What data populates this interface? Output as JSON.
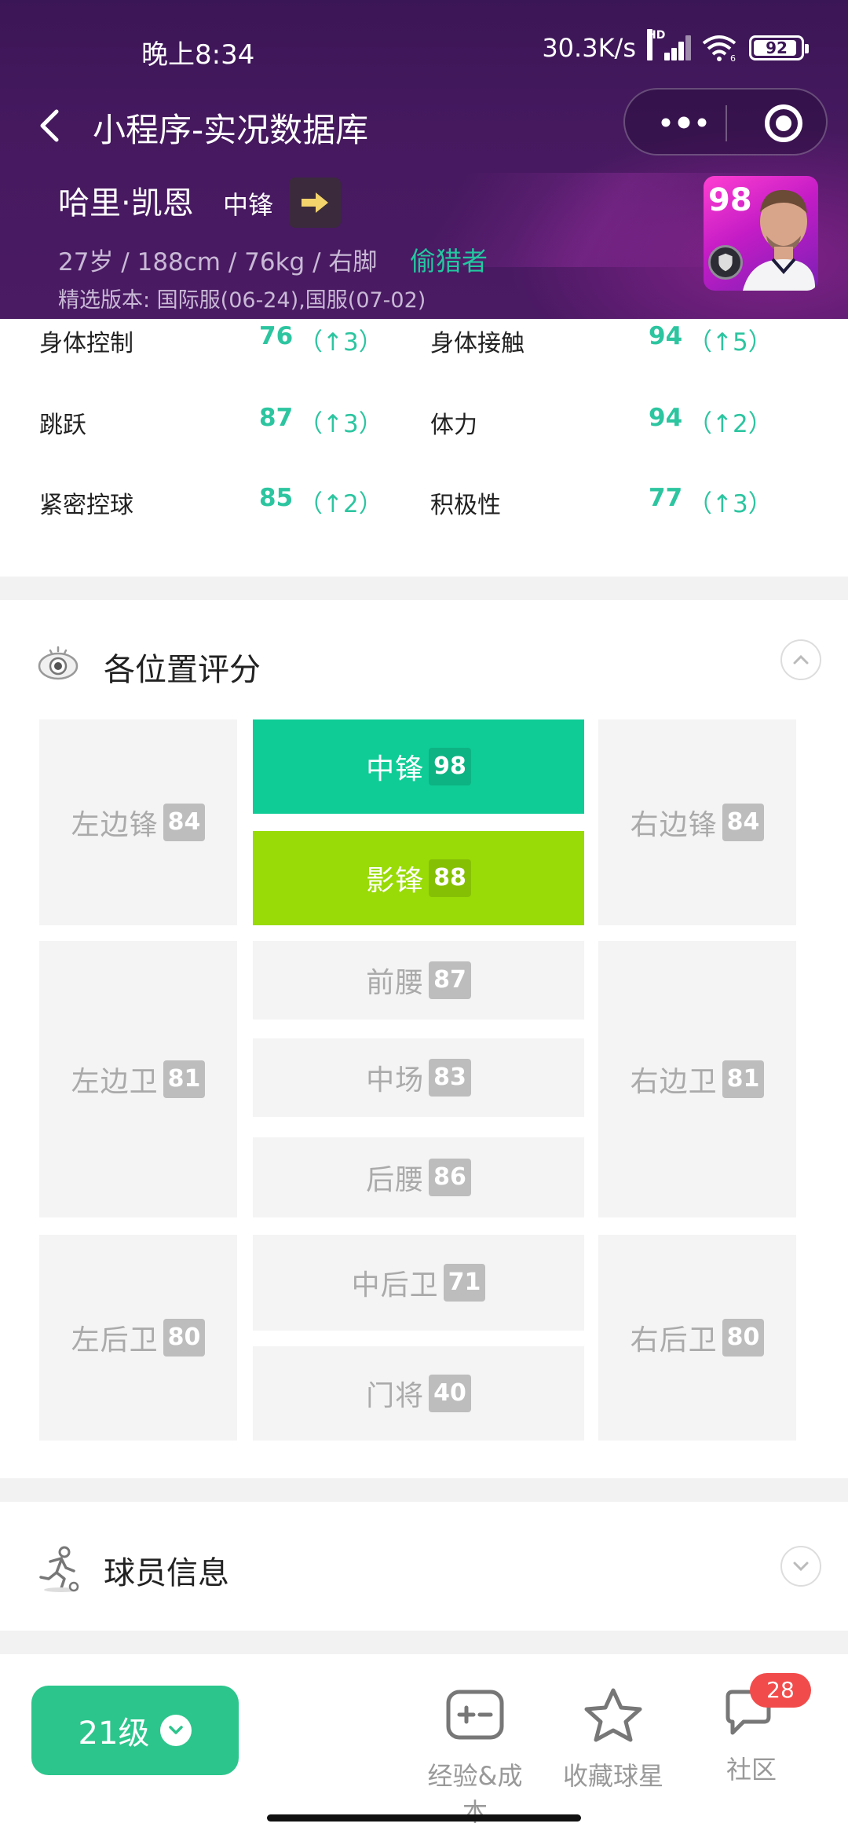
{
  "status": {
    "time": "晚上8:34",
    "net_speed": "30.3K/s",
    "signal_tag": "HD",
    "wifi_tag": "6",
    "battery": "92"
  },
  "nav": {
    "title": "小程序-实况数据库"
  },
  "player": {
    "name": "哈里·凯恩",
    "position": "中锋",
    "meta": "27岁 / 188cm / 76kg / 右脚",
    "style": "偷猎者",
    "version": "精选版本: 国际服(06-24),国服(07-02)",
    "card_rating": "98"
  },
  "attributes": [
    {
      "name": "身体控制",
      "value": "76",
      "delta": "（↑3）"
    },
    {
      "name": "身体接触",
      "value": "94",
      "delta": "（↑5）"
    },
    {
      "name": "跳跃",
      "value": "87",
      "delta": "（↑3）"
    },
    {
      "name": "体力",
      "value": "94",
      "delta": "（↑2）"
    },
    {
      "name": "紧密控球",
      "value": "85",
      "delta": "（↑2）"
    },
    {
      "name": "积极性",
      "value": "77",
      "delta": "（↑3）"
    }
  ],
  "position_section": {
    "title": "各位置评分",
    "positions": {
      "lwf": {
        "label": "左边锋",
        "rating": "84"
      },
      "cf": {
        "label": "中锋",
        "rating": "98"
      },
      "rwf": {
        "label": "右边锋",
        "rating": "84"
      },
      "ss": {
        "label": "影锋",
        "rating": "88"
      },
      "lmf": {
        "label": "左边卫",
        "rating": "81"
      },
      "amf": {
        "label": "前腰",
        "rating": "87"
      },
      "rmf": {
        "label": "右边卫",
        "rating": "81"
      },
      "cmf": {
        "label": "中场",
        "rating": "83"
      },
      "dmf": {
        "label": "后腰",
        "rating": "86"
      },
      "lb": {
        "label": "左后卫",
        "rating": "80"
      },
      "cb": {
        "label": "中后卫",
        "rating": "71"
      },
      "rb": {
        "label": "右后卫",
        "rating": "80"
      },
      "gk": {
        "label": "门将",
        "rating": "40"
      }
    },
    "colors": {
      "best": "#0fcc96",
      "second": "#99db06",
      "other": "#f4f4f4"
    }
  },
  "info_section": {
    "title": "球员信息"
  },
  "bottom": {
    "level": "21级",
    "tabs": [
      {
        "label": "经验&成本",
        "icon": "calculator-icon"
      },
      {
        "label": "收藏球星",
        "icon": "star-icon"
      },
      {
        "label": "社区",
        "icon": "chat-icon",
        "badge": "28"
      }
    ]
  }
}
